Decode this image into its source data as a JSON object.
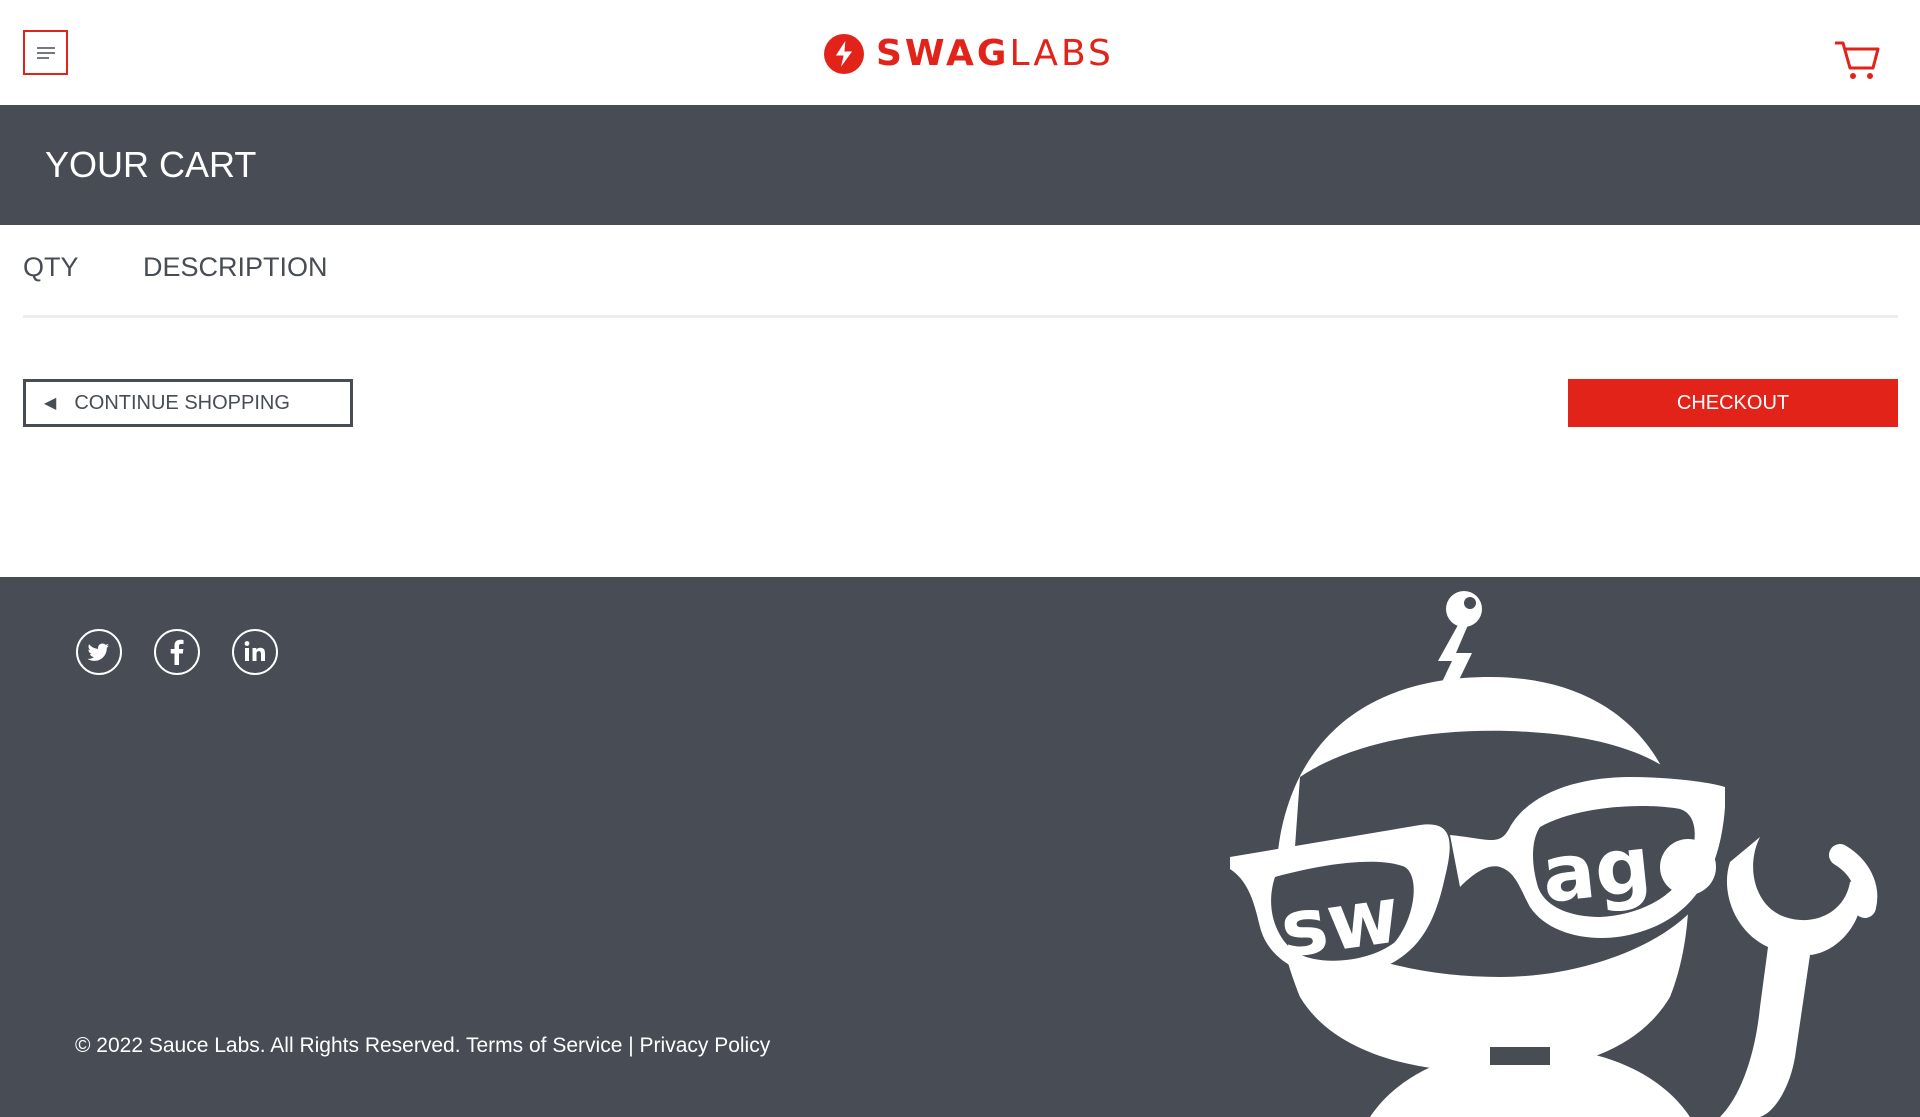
{
  "header": {
    "menu_icon": "hamburger-menu-icon",
    "logo": {
      "bold": "SWAG",
      "light": "LABS"
    },
    "cart_icon": "shopping-cart-icon",
    "accent_color": "#e2231a"
  },
  "subheader": {
    "title": "YOUR CART",
    "background": "#474c55"
  },
  "cart": {
    "columns": {
      "qty": "QTY",
      "description": "DESCRIPTION"
    },
    "items": []
  },
  "actions": {
    "continue_shopping": "CONTINUE SHOPPING",
    "continue_icon": "left-triangle-icon",
    "checkout": "CHECKOUT"
  },
  "footer": {
    "social": [
      "twitter-icon",
      "facebook-icon",
      "linkedin-icon"
    ],
    "copyright": "© 2022 Sauce Labs. All Rights Reserved.",
    "terms": "Terms of Service",
    "separator": "|",
    "privacy": "Privacy Policy",
    "robot_text": "swag"
  }
}
